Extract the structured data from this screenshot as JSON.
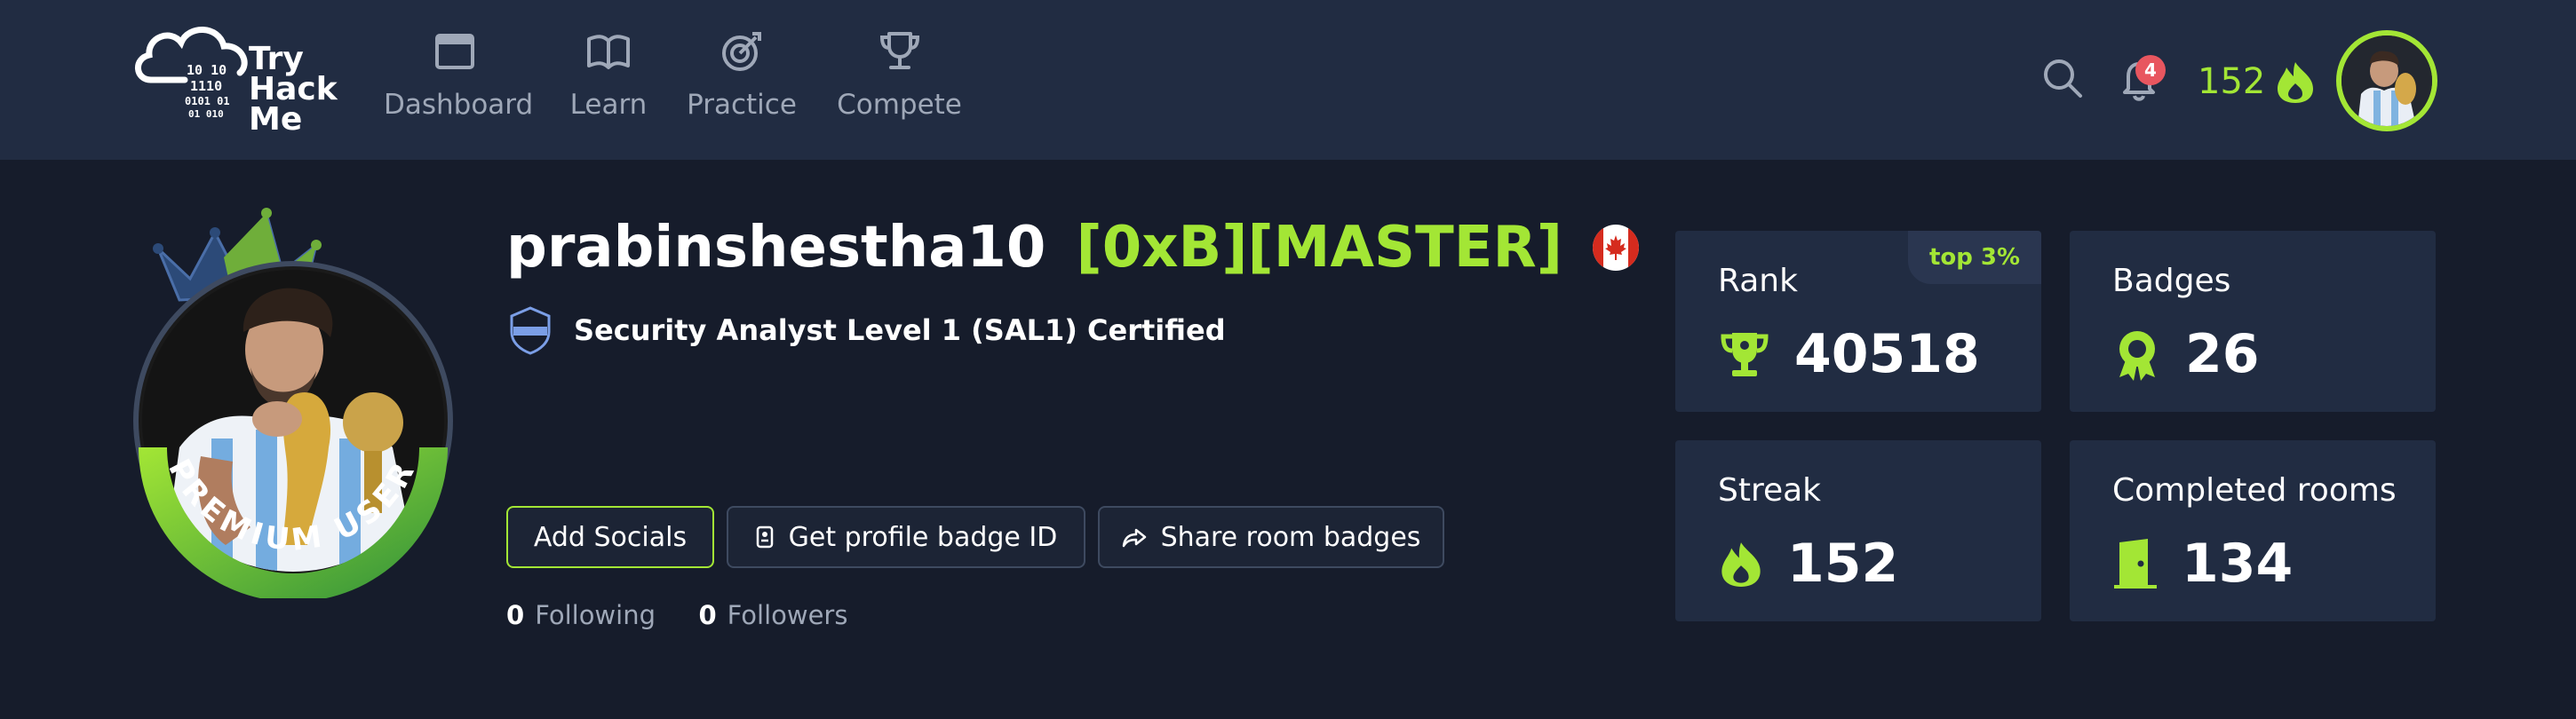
{
  "logo": {
    "lines": [
      "Try",
      "Hack",
      "Me"
    ],
    "binary": [
      "10  10",
      "1110",
      "0101  01",
      "01 010"
    ]
  },
  "nav": [
    {
      "label": "Dashboard",
      "icon": "dashboard-icon"
    },
    {
      "label": "Learn",
      "icon": "book-icon"
    },
    {
      "label": "Practice",
      "icon": "target-icon"
    },
    {
      "label": "Compete",
      "icon": "trophy-icon"
    }
  ],
  "header": {
    "notification_count": "4",
    "streak_count": "152"
  },
  "profile": {
    "username": "prabinshestha10",
    "rank_tag": "[0xB][MASTER]",
    "country_flag": "canada-flag",
    "certification": "Security Analyst Level 1 (SAL1) Certified",
    "premium_label": "PREMIUM USER"
  },
  "actions": {
    "add_socials": "Add Socials",
    "badge_id": "Get profile badge ID",
    "share": "Share room badges"
  },
  "social": {
    "following_count": "0",
    "following_label": "Following",
    "followers_count": "0",
    "followers_label": "Followers"
  },
  "stats": {
    "rank": {
      "label": "Rank",
      "value": "40518",
      "pill": "top 3%"
    },
    "badges": {
      "label": "Badges",
      "value": "26"
    },
    "streak": {
      "label": "Streak",
      "value": "152"
    },
    "rooms": {
      "label": "Completed rooms",
      "value": "134"
    }
  },
  "colors": {
    "accent": "#a3e635",
    "nav_bg": "#212c42",
    "page_bg": "#161c2b",
    "card_bg": "#212c42",
    "badge_red": "#e8565f"
  }
}
